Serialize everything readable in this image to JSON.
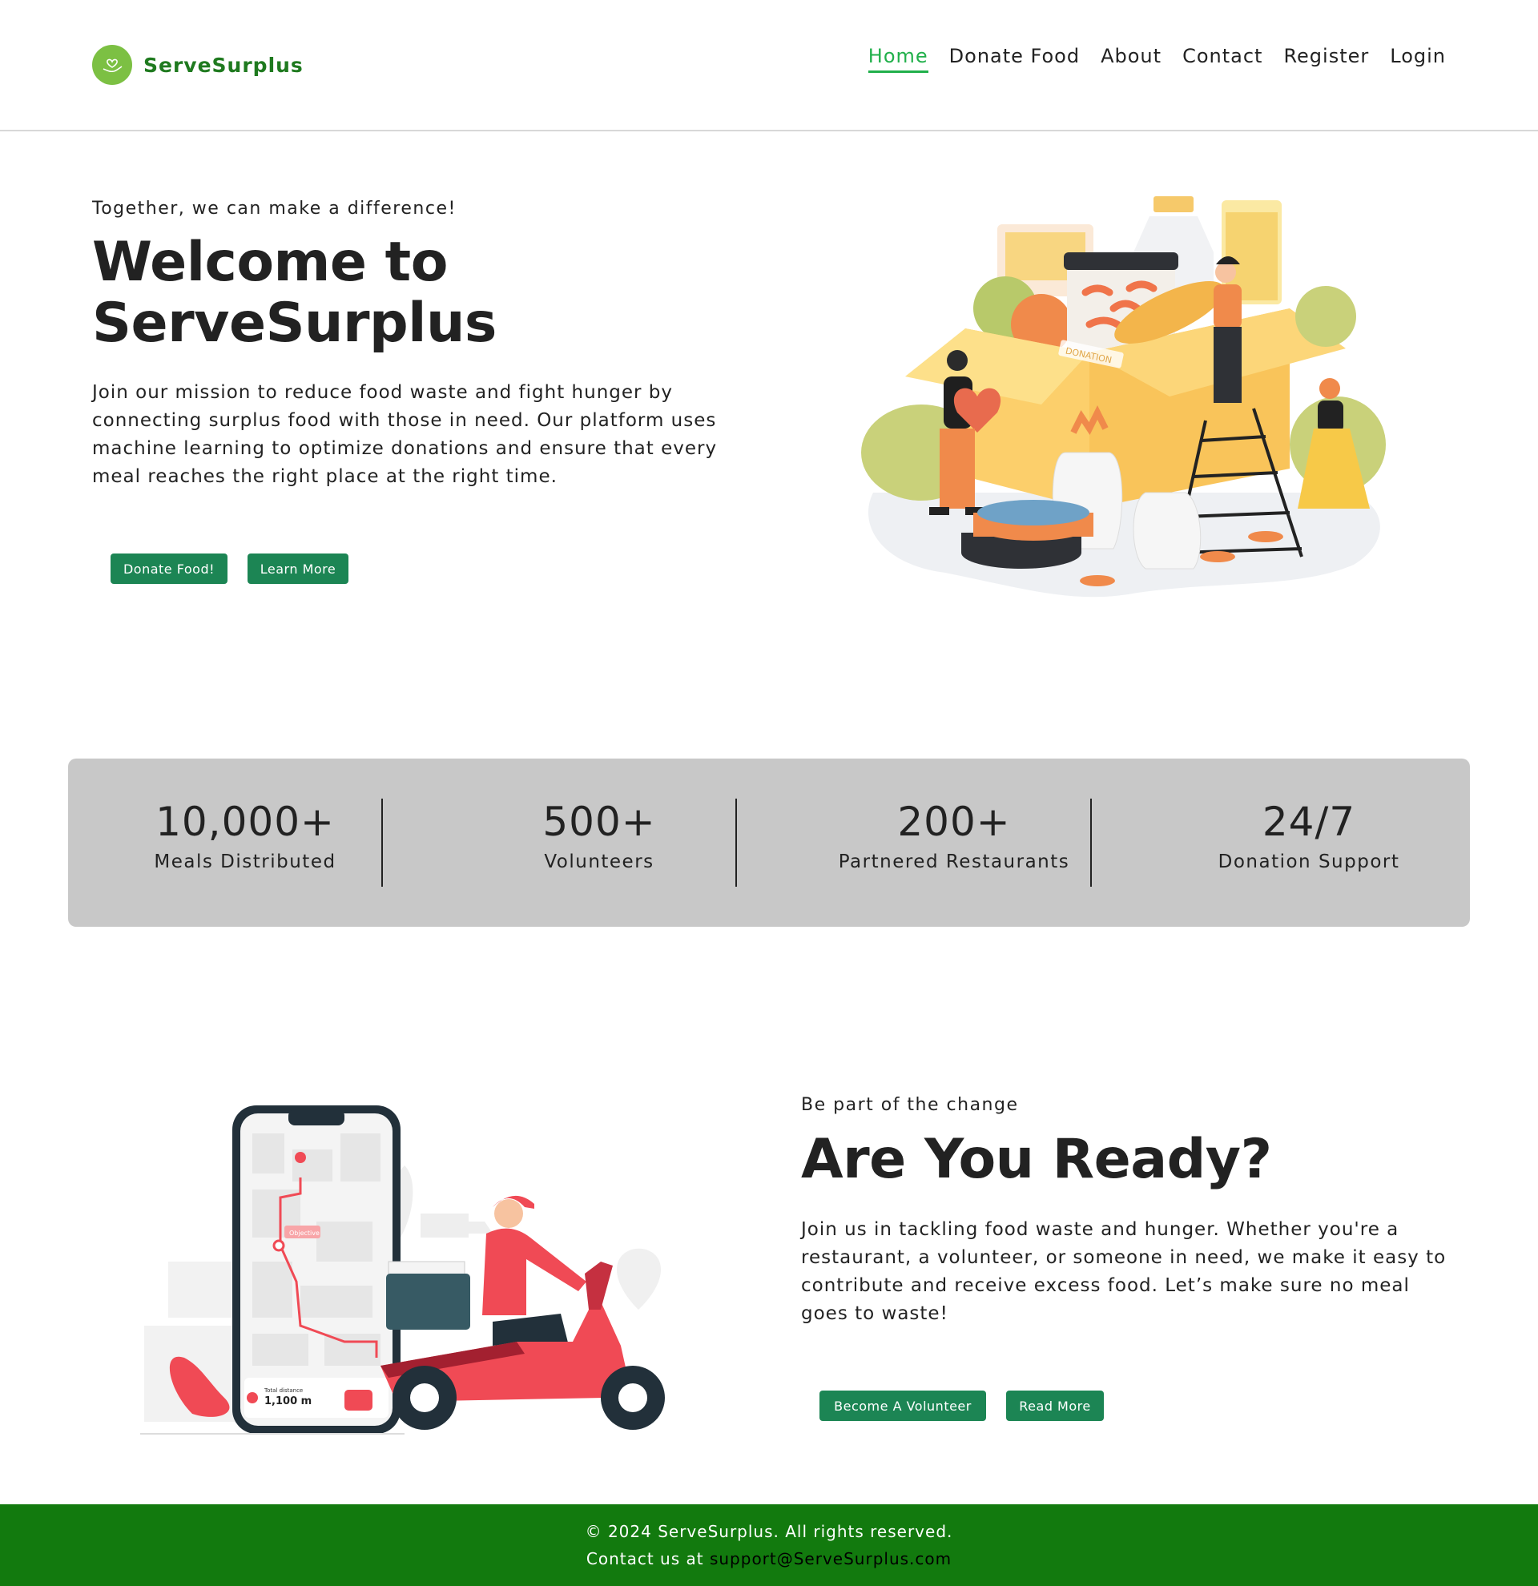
{
  "brand": {
    "name": "ServeSurplus",
    "logo_icon": "hand-heart-icon"
  },
  "nav": {
    "items": [
      {
        "label": "Home",
        "active": true
      },
      {
        "label": "Donate Food",
        "active": false
      },
      {
        "label": "About",
        "active": false
      },
      {
        "label": "Contact",
        "active": false
      },
      {
        "label": "Register",
        "active": false
      },
      {
        "label": "Login",
        "active": false
      }
    ]
  },
  "hero": {
    "tagline": "Together, we can make a difference!",
    "title": "Welcome to ServeSurplus",
    "description": "Join our mission to reduce food waste and fight hunger by connecting surplus food with those in need. Our platform uses machine learning to optimize donations and ensure that every meal reaches the right place at the right time.",
    "primary_button": "Donate Food!",
    "secondary_button": "Learn More",
    "illustration_label": "DONATION"
  },
  "stats": [
    {
      "value": "10,000+",
      "label": "Meals Distributed"
    },
    {
      "value": "500+",
      "label": "Volunteers"
    },
    {
      "value": "200+",
      "label": "Partnered Restaurants"
    },
    {
      "value": "24/7",
      "label": "Donation Support"
    }
  ],
  "cta": {
    "tagline": "Be part of the change",
    "title": "Are You Ready?",
    "description": "Join us in tackling food waste and hunger. Whether you're a restaurant, a volunteer, or someone in need, we make it easy to contribute and receive excess food. Let’s make sure no meal goes to waste!",
    "primary_button": "Become A Volunteer",
    "secondary_button": "Read More",
    "phone_objective": "Objective",
    "phone_distance_label": "Total distance",
    "phone_distance_value": "1,100 m"
  },
  "footer": {
    "copyright": "© 2024 ServeSurplus. All rights reserved.",
    "contact_prefix": "Contact us at ",
    "contact_email": "support@ServeSurplus.com"
  },
  "colors": {
    "accent_green": "#1c8554",
    "nav_active": "#21b04b",
    "footer_bg": "#127a0e",
    "stats_bg": "#c8c8c8"
  }
}
